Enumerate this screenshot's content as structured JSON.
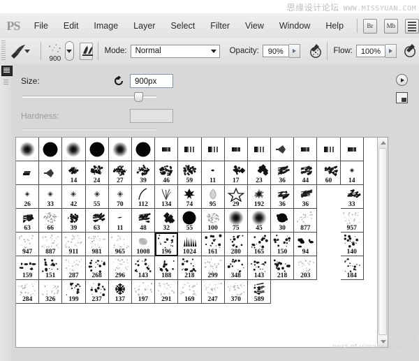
{
  "watermark": {
    "top_cn": "思缘设计论坛",
    "top_en": "WWW.MISSYUAN.COM",
    "bottom": "post of uimaker.com"
  },
  "menubar": {
    "logo": "PS",
    "items": [
      {
        "label": "File"
      },
      {
        "label": "Edit"
      },
      {
        "label": "Image"
      },
      {
        "label": "Layer"
      },
      {
        "label": "Select"
      },
      {
        "label": "Filter"
      },
      {
        "label": "View"
      },
      {
        "label": "Window"
      },
      {
        "label": "Help"
      }
    ],
    "app_buttons": [
      {
        "label": "Br",
        "name": "bridge-button"
      },
      {
        "label": "Mb",
        "name": "mini-bridge-button"
      }
    ]
  },
  "options_bar": {
    "tool_icon": "brush-tool-icon",
    "brush_size_preview": "900",
    "mode_label": "Mode:",
    "mode_value": "Normal",
    "opacity_label": "Opacity:",
    "opacity_value": "90%",
    "flow_label": "Flow:",
    "flow_value": "100%",
    "airbrush_icon": "airbrush-icon",
    "toggle_panel_icon": "toggle-brush-panel-icon"
  },
  "brush_picker": {
    "size_label": "Size:",
    "size_value": "900px",
    "size_slider_percent": 84,
    "hardness_label": "Hardness:",
    "hardness_value": "",
    "hardness_slider_percent": 0,
    "reset_icon": "reset-brush-icon",
    "panel_menu_icon": "panel-menu-icon",
    "preset_manager_icon": "preset-manager-icon",
    "selected_index": 66,
    "columns": 15,
    "brushes": [
      {
        "cap": "",
        "type": "soft",
        "size": 14
      },
      {
        "cap": "",
        "type": "hard",
        "size": 23
      },
      {
        "cap": "",
        "type": "soft",
        "size": 13
      },
      {
        "cap": "",
        "type": "hard",
        "size": 24
      },
      {
        "cap": "",
        "type": "soft",
        "size": 12
      },
      {
        "cap": "",
        "type": "hard",
        "size": 23
      },
      {
        "cap": "",
        "type": "flat",
        "size": 18
      },
      {
        "cap": "",
        "type": "chisel",
        "size": 18
      },
      {
        "cap": "",
        "type": "chisel",
        "size": 18
      },
      {
        "cap": "",
        "type": "flat",
        "size": 14
      },
      {
        "cap": "",
        "type": "chisel",
        "size": 17
      },
      {
        "cap": "",
        "type": "cone",
        "size": 16
      },
      {
        "cap": "",
        "type": "flat",
        "size": 15
      },
      {
        "cap": "",
        "type": "chisel",
        "size": 16
      },
      {
        "cap": "",
        "type": "flat",
        "size": 16
      },
      {
        "cap": "",
        "type": "wedge",
        "size": 16
      },
      {
        "cap": "",
        "type": "cone",
        "size": 17
      },
      {
        "cap": "14",
        "type": "spatter",
        "size": 11
      },
      {
        "cap": "24",
        "type": "spatter",
        "size": 15
      },
      {
        "cap": "27",
        "type": "spatter",
        "size": 16
      },
      {
        "cap": "39",
        "type": "spatter",
        "size": 16
      },
      {
        "cap": "46",
        "type": "spatter",
        "size": 17
      },
      {
        "cap": "59",
        "type": "spatter",
        "size": 17
      },
      {
        "cap": "11",
        "type": "leafsm",
        "size": 8
      },
      {
        "cap": "17",
        "type": "leaf",
        "size": 13
      },
      {
        "cap": "23",
        "type": "leaf",
        "size": 14
      },
      {
        "cap": "36",
        "type": "scratch",
        "size": 15
      },
      {
        "cap": "44",
        "type": "scratch",
        "size": 15
      },
      {
        "cap": "60",
        "type": "scratch",
        "size": 15
      },
      {
        "cap": "14",
        "type": "star",
        "size": 5
      },
      {
        "cap": "26",
        "type": "star",
        "size": 6
      },
      {
        "cap": "33",
        "type": "star",
        "size": 7
      },
      {
        "cap": "42",
        "type": "star",
        "size": 8
      },
      {
        "cap": "55",
        "type": "star",
        "size": 8
      },
      {
        "cap": "70",
        "type": "star",
        "size": 9
      },
      {
        "cap": "112",
        "type": "arc",
        "size": 16
      },
      {
        "cap": "134",
        "type": "grass",
        "size": 16
      },
      {
        "cap": "74",
        "type": "maple",
        "size": 15
      },
      {
        "cap": "95",
        "type": "petal",
        "size": 15
      },
      {
        "cap": "29",
        "type": "starout",
        "size": 16
      },
      {
        "cap": "192",
        "type": "burst",
        "size": 11
      },
      {
        "cap": "36",
        "type": "scratch",
        "size": 14
      },
      {
        "cap": "36",
        "type": "scratch",
        "size": 14
      },
      {
        "cap": "",
        "type": "blank",
        "size": 0
      },
      {
        "cap": "33",
        "type": "scratch",
        "size": 14
      },
      {
        "cap": "63",
        "type": "scratch",
        "size": 14
      },
      {
        "cap": "66",
        "type": "speckle",
        "size": 16
      },
      {
        "cap": "39",
        "type": "spatter",
        "size": 14
      },
      {
        "cap": "63",
        "type": "scratch",
        "size": 14
      },
      {
        "cap": "11",
        "type": "dash",
        "size": 8
      },
      {
        "cap": "48",
        "type": "scratch",
        "size": 14
      },
      {
        "cap": "32",
        "type": "leaf",
        "size": 14
      },
      {
        "cap": "55",
        "type": "hard",
        "size": 15
      },
      {
        "cap": "100",
        "type": "speckle",
        "size": 17
      },
      {
        "cap": "75",
        "type": "soft",
        "size": 12
      },
      {
        "cap": "45",
        "type": "soft",
        "size": 11
      },
      {
        "cap": "30",
        "type": "blob",
        "size": 14
      },
      {
        "cap": "877",
        "type": "sparse",
        "size": 17
      },
      {
        "cap": "",
        "type": "blank",
        "size": 0
      },
      {
        "cap": "957",
        "type": "sparse",
        "size": 18
      },
      {
        "cap": "947",
        "type": "sparse",
        "size": 16
      },
      {
        "cap": "887",
        "type": "sparse",
        "size": 18
      },
      {
        "cap": "911",
        "type": "sparse",
        "size": 18
      },
      {
        "cap": "981",
        "type": "sparse",
        "size": 18
      },
      {
        "cap": "965",
        "type": "sparse",
        "size": 16
      },
      {
        "cap": "1008",
        "type": "smudge",
        "size": 14
      },
      {
        "cap": "196",
        "type": "dots",
        "size": 15
      },
      {
        "cap": "1024",
        "type": "strokes",
        "size": 15
      },
      {
        "cap": "161",
        "type": "dots",
        "size": 15
      },
      {
        "cap": "280",
        "type": "dots",
        "size": 15
      },
      {
        "cap": "165",
        "type": "dots",
        "size": 15
      },
      {
        "cap": "150",
        "type": "dots",
        "size": 15
      },
      {
        "cap": "94",
        "type": "blobs",
        "size": 14
      },
      {
        "cap": "",
        "type": "blank",
        "size": 0
      },
      {
        "cap": "140",
        "type": "dots",
        "size": 16
      },
      {
        "cap": "159",
        "type": "blobs",
        "size": 16
      },
      {
        "cap": "151",
        "type": "dots",
        "size": 16
      },
      {
        "cap": "287",
        "type": "sparse",
        "size": 16
      },
      {
        "cap": "268",
        "type": "dots",
        "size": 16
      },
      {
        "cap": "296",
        "type": "sparse",
        "size": 16
      },
      {
        "cap": "143",
        "type": "dots",
        "size": 16
      },
      {
        "cap": "188",
        "type": "dots",
        "size": 16
      },
      {
        "cap": "218",
        "type": "dots",
        "size": 16
      },
      {
        "cap": "299",
        "type": "sparse",
        "size": 16
      },
      {
        "cap": "348",
        "type": "dots",
        "size": 16
      },
      {
        "cap": "143",
        "type": "dots",
        "size": 16
      },
      {
        "cap": "218",
        "type": "dots",
        "size": 16
      },
      {
        "cap": "203",
        "type": "sparse",
        "size": 16
      },
      {
        "cap": "",
        "type": "blank",
        "size": 0
      },
      {
        "cap": "184",
        "type": "dots",
        "size": 16
      },
      {
        "cap": "284",
        "type": "sparse",
        "size": 16
      },
      {
        "cap": "326",
        "type": "sparse",
        "size": 16
      },
      {
        "cap": "199",
        "type": "dots",
        "size": 16
      },
      {
        "cap": "237",
        "type": "dots",
        "size": 16
      },
      {
        "cap": "137",
        "type": "snow",
        "size": 15
      },
      {
        "cap": "197",
        "type": "sparse",
        "size": 16
      },
      {
        "cap": "291",
        "type": "sparse",
        "size": 16
      },
      {
        "cap": "169",
        "type": "sparse",
        "size": 16
      },
      {
        "cap": "247",
        "type": "sparse",
        "size": 16
      },
      {
        "cap": "370",
        "type": "sparse",
        "size": 16
      },
      {
        "cap": "589",
        "type": "grassy",
        "size": 16
      }
    ]
  },
  "scrollbar": {
    "up_icon": "scroll-up-arrow-icon",
    "down_icon": "scroll-down-arrow-icon",
    "thumb": "scroll-thumb"
  }
}
